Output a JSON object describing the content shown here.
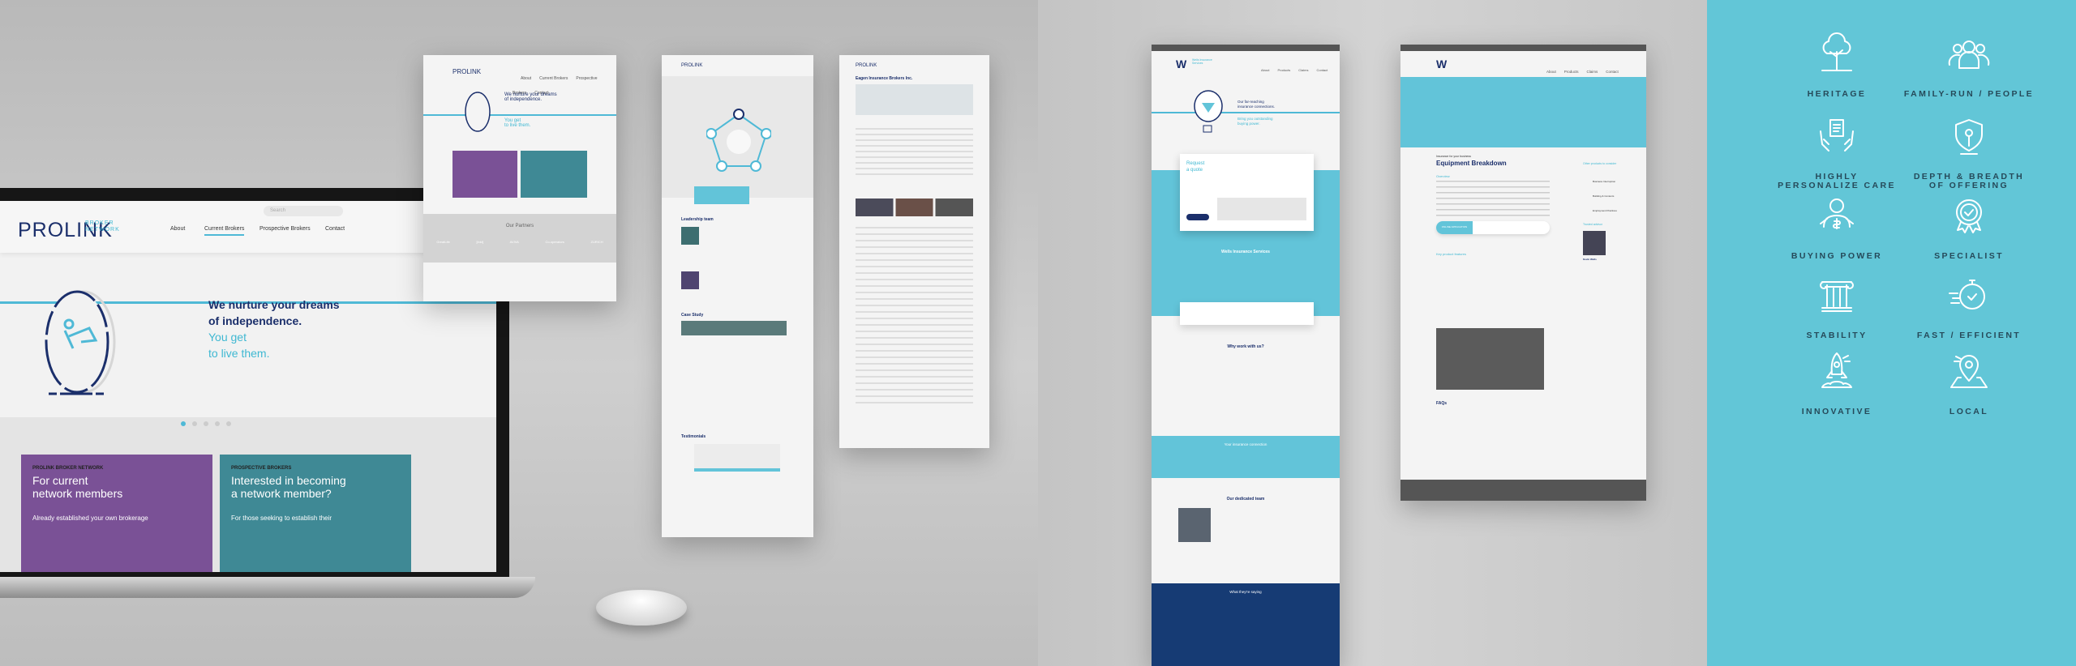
{
  "prolink": {
    "logo_main": "PROLINK",
    "logo_sub": "BROKER NETWORK",
    "search_placeholder": "Search",
    "nav": [
      "About",
      "Current Brokers",
      "Prospective Brokers",
      "Contact"
    ],
    "active_nav": "Current Brokers",
    "hero_title_1": "We nurture your dreams",
    "hero_title_2": "of independence.",
    "hero_sub_1": "You get",
    "hero_sub_2": "to live them.",
    "carousel_dots": 5,
    "card1": {
      "eyebrow": "PROLINK BROKER NETWORK",
      "title_1": "For current",
      "title_2": "network members",
      "body": "Already established your own brokerage",
      "color": "#7a5196"
    },
    "card2": {
      "eyebrow": "PROSPECTIVE BROKERS",
      "title_1": "Interested in becoming",
      "title_2": "a network member?",
      "body": "For those seeking to establish their",
      "color": "#3f8995"
    },
    "partners_title": "Our Partners",
    "partners": [
      "GreatLife",
      "[inkt]",
      "AVIVA",
      "Co-operators",
      "ZURICH"
    ],
    "leadership_title": "Leadership team",
    "case_study_title": "Case Study",
    "testimonials_title": "Testimonials",
    "eagen_title": "Eagen Insurance Brokers Inc."
  },
  "wells": {
    "logo": "Wells Insurance Services",
    "nav": [
      "About",
      "Products",
      "Claims",
      "Contact"
    ],
    "hero_title_1": "Our far-reaching",
    "hero_title_2": "insurance connections.",
    "hero_sub_1": "Bring you outstanding",
    "hero_sub_2": "buying power.",
    "quote_title_1": "Request",
    "quote_title_2": "a quote",
    "section_title": "Wells Insurance Services",
    "why_title": "Why work with us?",
    "connection_title": "Your insurance connection",
    "team_title": "Our dedicated team",
    "saying_title": "What they're saying",
    "product_eyebrow": "Insurance for your business",
    "product_title": "Equipment Breakdown",
    "overview_label": "Overview",
    "online_app": "ONLINE APPLICATION",
    "features_label": "Key product features",
    "other_products": "Other products to consider",
    "other_list": [
      "Business Interruption",
      "Building & Contents",
      "Employment Practices"
    ],
    "trusted_advisor": "Trusted advisor",
    "advisor_name": "Kevin Wells",
    "faqs_title": "FAQs",
    "accent": "#62c4d9",
    "navy": "#1b2f6b"
  },
  "values": [
    {
      "label": "HERITAGE",
      "icon": "tree-icon"
    },
    {
      "label": "FAMILY-RUN / PEOPLE",
      "icon": "people-icon"
    },
    {
      "label": "HIGHLY\nPERSONALIZE CARE",
      "icon": "hands-document-icon"
    },
    {
      "label": "DEPTH & BREADTH\nOF OFFERING",
      "icon": "shield-icon"
    },
    {
      "label": "BUYING POWER",
      "icon": "strongman-dollar-icon"
    },
    {
      "label": "SPECIALIST",
      "icon": "award-badge-icon"
    },
    {
      "label": "STABILITY",
      "icon": "column-icon"
    },
    {
      "label": "FAST / EFFICIENT",
      "icon": "stopwatch-icon"
    },
    {
      "label": "INNOVATIVE",
      "icon": "rocket-icon"
    },
    {
      "label": "LOCAL",
      "icon": "map-pin-icon"
    }
  ],
  "panel_color": "#62c6d7"
}
